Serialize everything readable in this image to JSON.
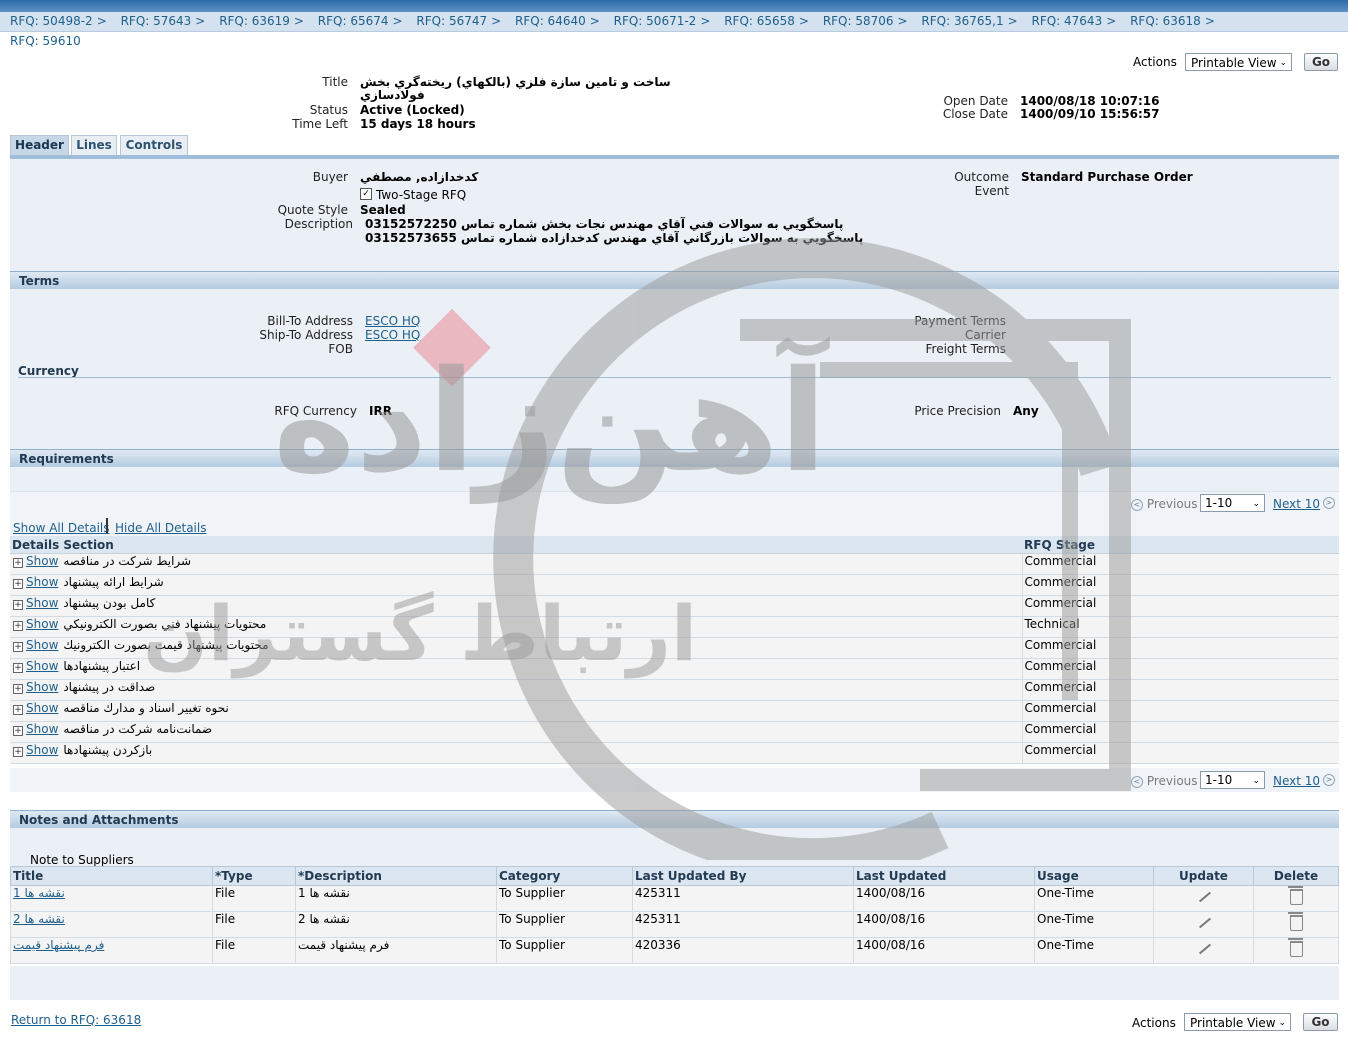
{
  "breadcrumbs": [
    "RFQ: 50498-2",
    "RFQ: 57643",
    "RFQ: 63619",
    "RFQ: 65674",
    "RFQ: 56747",
    "RFQ: 64640",
    "RFQ: 50671-2",
    "RFQ: 65658",
    "RFQ: 58706",
    "RFQ: 36765,1",
    "RFQ: 47643",
    "RFQ: 63618"
  ],
  "breadcrumb_sep": ">",
  "page_title": "RFQ: 59610",
  "actions": {
    "label": "Actions",
    "selected": "Printable View",
    "go": "Go"
  },
  "header_info": {
    "title_label": "Title",
    "title_value_1": "ساخت و تامين سازة فلزي (بالكهاي) ريخته‌گري بخش",
    "title_value_2": "فولادسازي",
    "status_label": "Status",
    "status_value": "Active (Locked)",
    "time_left_label": "Time Left",
    "time_left_value": "15 days 18 hours",
    "open_date_label": "Open Date",
    "open_date_value": "1400/08/18 10:07:16",
    "close_date_label": "Close Date",
    "close_date_value": "1400/09/10 15:56:57"
  },
  "tabs": [
    "Header",
    "Lines",
    "Controls"
  ],
  "header_panel": {
    "buyer_label": "Buyer",
    "buyer_value": "كدخدازاده, مصطفي",
    "two_stage_label": "Two-Stage RFQ",
    "quote_style_label": "Quote Style",
    "quote_style_value": "Sealed",
    "description_label": "Description",
    "description_line_1": "پاسخگويي به سوالات فني آقاي مهندس نجات بخش شماره تماس 03152572250",
    "description_line_2": "پاسخگويي به سوالات بازرگاني آقاي مهندس كدخدازاده شماره تماس 03152573655",
    "outcome_label": "Outcome",
    "outcome_value": "Standard Purchase Order",
    "event_label": "Event"
  },
  "terms": {
    "title": "Terms",
    "bill_to_label": "Bill-To Address",
    "bill_to_value": "ESCO HQ",
    "ship_to_label": "Ship-To Address",
    "ship_to_value": "ESCO HQ",
    "fob_label": "FOB",
    "payment_terms_label": "Payment Terms",
    "carrier_label": "Carrier",
    "freight_terms_label": "Freight Terms",
    "currency_title": "Currency",
    "rfq_currency_label": "RFQ Currency",
    "rfq_currency_value": "IRR",
    "price_precision_label": "Price Precision",
    "price_precision_value": "Any"
  },
  "requirements": {
    "title": "Requirements",
    "previous": "Previous",
    "range": "1-10",
    "next": "Next 10",
    "show_all": "Show All Details",
    "hide_all": "Hide All Details",
    "columns": [
      "Details",
      "Section",
      "RFQ Stage"
    ],
    "show_label": "Show",
    "rows": [
      {
        "section": "شرايط شركت در مناقصه",
        "stage": "Commercial"
      },
      {
        "section": "شرايط ارائه پيشنهاد",
        "stage": "Commercial"
      },
      {
        "section": "كامل بودن پيشنهاد",
        "stage": "Commercial"
      },
      {
        "section": "محتويات پيشنهاد فني بصورت الكترونيكي",
        "stage": "Technical"
      },
      {
        "section": "محتويات پيشنهاد قيمت بصورت الكترونيك",
        "stage": "Commercial"
      },
      {
        "section": "اعتبار پيشنهادها",
        "stage": "Commercial"
      },
      {
        "section": "صداقت در پيشنهاد",
        "stage": "Commercial"
      },
      {
        "section": "نحوه تغيير اسناد و مدارك مناقصه",
        "stage": "Commercial"
      },
      {
        "section": "ضمانت‌نامه شركت در مناقصه",
        "stage": "Commercial"
      },
      {
        "section": "بازكردن پيشنهادها",
        "stage": "Commercial"
      }
    ]
  },
  "notes": {
    "title": "Notes and Attachments",
    "note_to_suppliers": "Note to Suppliers",
    "columns": [
      "Title",
      "*Type",
      "*Description",
      "Category",
      "Last Updated By",
      "Last Updated",
      "Usage",
      "Update",
      "Delete"
    ],
    "rows": [
      {
        "title": "نقشه ها 1",
        "type": "File",
        "description": "نقشه ها 1",
        "category": "To Supplier",
        "updated_by": "425311",
        "updated": "1400/08/16",
        "usage": "One-Time"
      },
      {
        "title": "نقشه ها 2",
        "type": "File",
        "description": "نقشه ها 2",
        "category": "To Supplier",
        "updated_by": "425311",
        "updated": "1400/08/16",
        "usage": "One-Time"
      },
      {
        "title": "فرم پيشنهاد قيمت",
        "type": "File",
        "description": "فرم پيشنهاد قيمت",
        "category": "To Supplier",
        "updated_by": "420336",
        "updated": "1400/08/16",
        "usage": "One-Time"
      }
    ]
  },
  "return_link": "Return to RFQ: 63618",
  "watermark_text_1": "آهن‌زاده",
  "watermark_text_2": "ارتباط گستران",
  "colors": {
    "header_blue": "#2d6aa8",
    "section_bg": "#b5cbe0",
    "panel_bg": "#eaf0f6",
    "link": "#1f5f8b",
    "watermark": "#9a9a9a",
    "watermark_accent": "#e8505b"
  }
}
